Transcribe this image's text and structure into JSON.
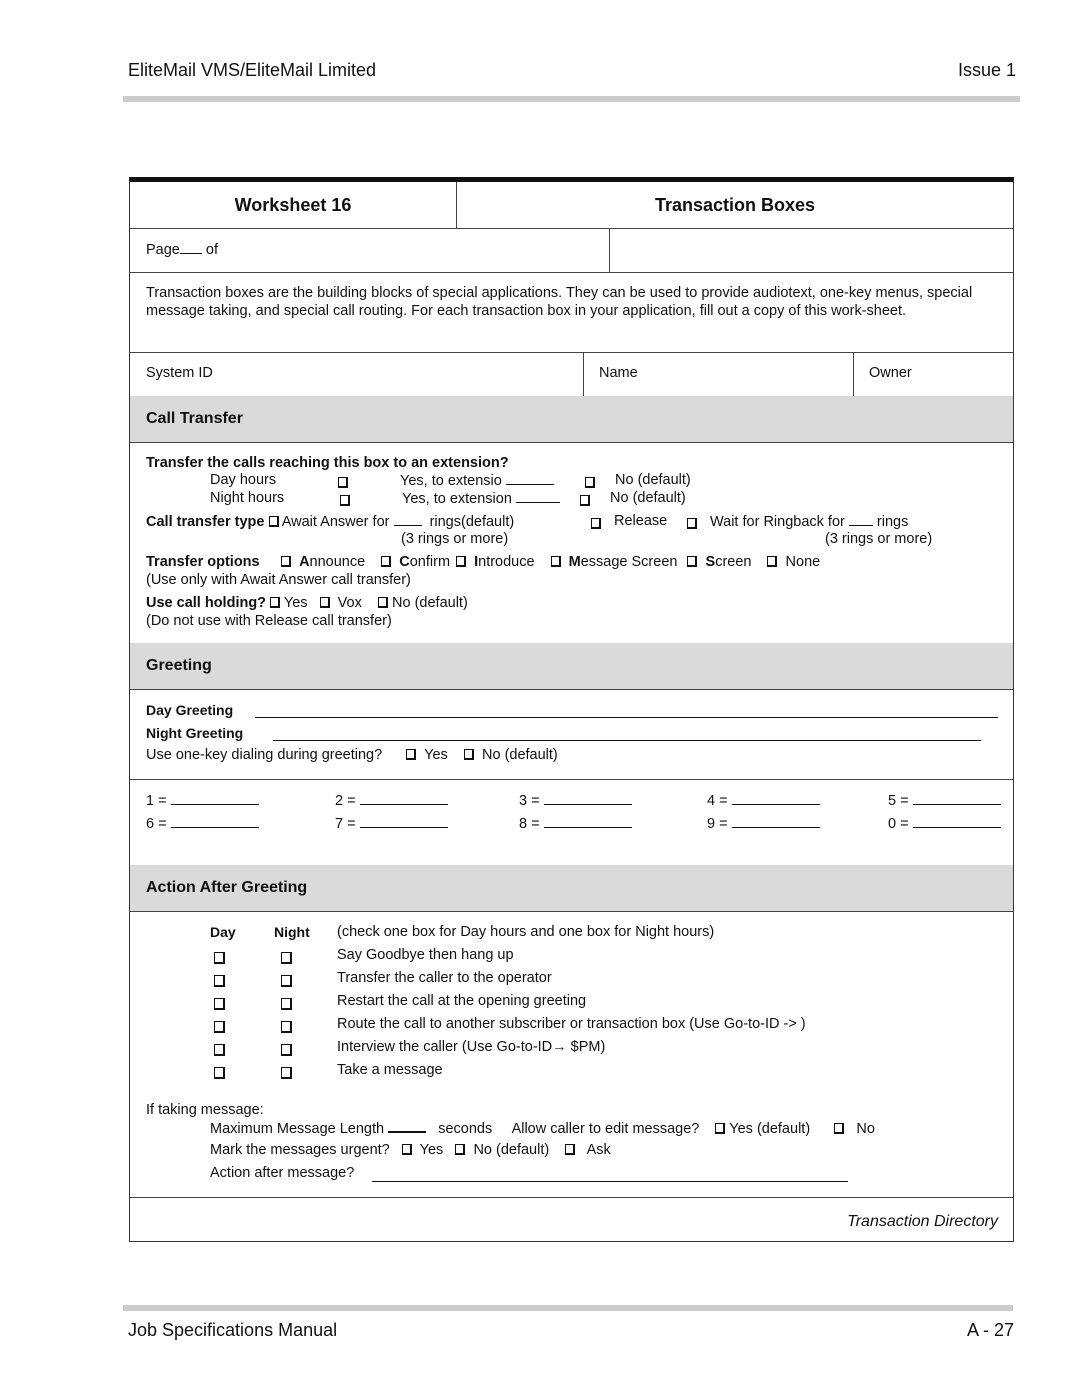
{
  "header": {
    "title": "EliteMail VMS/EliteMail Limited",
    "issue": "Issue 1"
  },
  "footer": {
    "manual": "Job Specifications Manual",
    "page": "A - 27"
  },
  "worksheet": {
    "number": "Worksheet 16",
    "title": "Transaction Boxes",
    "page_label": "Page",
    "page_of": "of",
    "intro": "Transaction boxes are the building blocks of special applications. They can be used to provide audiotext, one-key menus, special message taking, and special call routing. For each transaction box in your application, fill out a copy of this work-sheet.",
    "fields": {
      "system_id": "System ID",
      "name": "Name",
      "owner": "Owner"
    }
  },
  "call_transfer": {
    "heading": "Call Transfer",
    "question": "Transfer the calls reaching this box to an extension?",
    "day_label": "Day hours",
    "night_label": "Night hours",
    "day_yes": "Yes, to extensio",
    "night_yes": "Yes, to extension",
    "no_default": "No (default)",
    "type_label": "Call transfer type",
    "await_answer": "Await Answer  for",
    "rings_default": "rings(default)",
    "rings_note": "(3 rings or more)",
    "release": "Release",
    "wait_ringback": "Wait for Ringback  for",
    "rings": "rings",
    "options_label": "Transfer options",
    "options": [
      {
        "initial": "A",
        "rest": "nnounce"
      },
      {
        "initial": "C",
        "rest": "onfirm"
      },
      {
        "initial": "I",
        "rest": "ntroduce"
      },
      {
        "initial": "M",
        "rest": "essage Screen"
      },
      {
        "initial": "S",
        "rest": "creen"
      },
      {
        "initial": "",
        "rest": "None"
      }
    ],
    "options_note": "(Use only with Await Answer call transfer)",
    "holding_label": "Use call holding?",
    "holding_yes": "Yes",
    "holding_vox": "Vox",
    "holding_no": "No (default)",
    "holding_note": "(Do not use with Release call transfer)"
  },
  "greeting": {
    "heading": "Greeting",
    "day": "Day Greeting",
    "night": "Night Greeting",
    "one_key": "Use one-key dialing during greeting?",
    "yes": "Yes",
    "no": "No (default)",
    "keys": [
      "1 =",
      "2 =",
      "3 =",
      "4 =",
      "5 =",
      "6 =",
      "7 =",
      "8 =",
      "9 =",
      "0 ="
    ]
  },
  "action_after": {
    "heading": "Action After Greeting",
    "col_day": "Day",
    "col_night": "Night",
    "instruction": "(check one box for Day hours and one box for Night hours)",
    "items": [
      "Say Goodbye then hang up",
      "Transfer the caller to the operator",
      "Restart the call at the opening greeting",
      "Route the call to another subscriber or transaction box  (Use Go-to-ID -> )",
      "Interview the caller  (Use Go-to-ID→ $PM)",
      "Take a message"
    ],
    "if_taking": "If taking message:",
    "max_length": "Maximum Message Length",
    "seconds": "seconds",
    "allow_edit": "Allow caller to edit message?",
    "edit_yes": "Yes (default)",
    "edit_no": "No",
    "urgent": "Mark the messages urgent?",
    "urgent_yes": "Yes",
    "urgent_no": "No (default)",
    "urgent_ask": "Ask",
    "after_msg": "Action after message?"
  },
  "bottom_note": "Transaction Directory"
}
